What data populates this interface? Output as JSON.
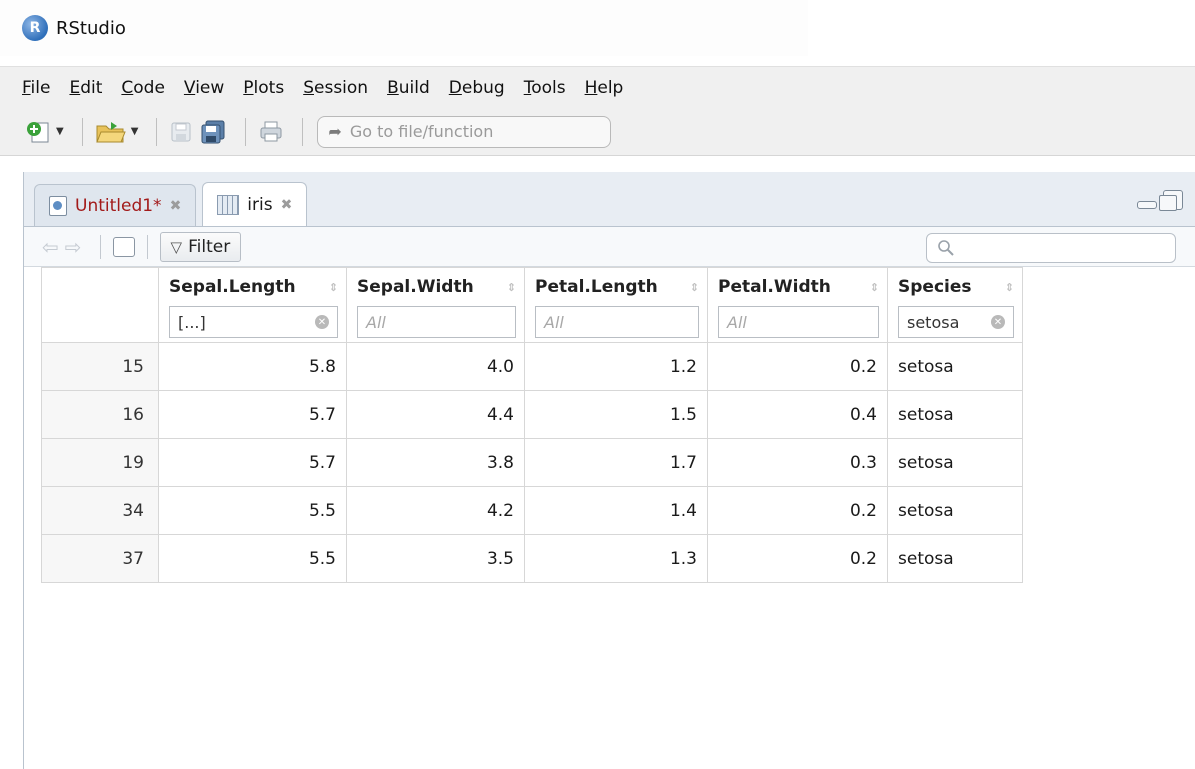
{
  "window": {
    "title": "RStudio"
  },
  "menu": [
    {
      "pre": "",
      "u": "F",
      "post": "ile"
    },
    {
      "pre": "",
      "u": "E",
      "post": "dit"
    },
    {
      "pre": "",
      "u": "C",
      "post": "ode"
    },
    {
      "pre": "",
      "u": "V",
      "post": "iew"
    },
    {
      "pre": "",
      "u": "P",
      "post": "lots"
    },
    {
      "pre": "",
      "u": "S",
      "post": "ession"
    },
    {
      "pre": "",
      "u": "B",
      "post": "uild"
    },
    {
      "pre": "",
      "u": "D",
      "post": "ebug"
    },
    {
      "pre": "",
      "u": "T",
      "post": "ools"
    },
    {
      "pre": "",
      "u": "H",
      "post": "elp"
    }
  ],
  "toolbar": {
    "goto_placeholder": "Go to file/function"
  },
  "tabs": [
    {
      "label": "Untitled1*",
      "modified": true
    },
    {
      "label": "iris",
      "modified": false
    }
  ],
  "viewer": {
    "filter_label": "Filter",
    "search_icon": "magnifier-icon"
  },
  "table": {
    "columns": [
      {
        "name": "Sepal.Length",
        "filter": "[...]",
        "filter_is_placeholder": false,
        "clearable": true
      },
      {
        "name": "Sepal.Width",
        "filter": "All",
        "filter_is_placeholder": true,
        "clearable": false
      },
      {
        "name": "Petal.Length",
        "filter": "All",
        "filter_is_placeholder": true,
        "clearable": false
      },
      {
        "name": "Petal.Width",
        "filter": "All",
        "filter_is_placeholder": true,
        "clearable": false
      },
      {
        "name": "Species",
        "filter": "setosa",
        "filter_is_placeholder": false,
        "clearable": true
      }
    ],
    "rows": [
      {
        "id": "15",
        "cells": [
          "5.8",
          "4.0",
          "1.2",
          "0.2",
          "setosa"
        ]
      },
      {
        "id": "16",
        "cells": [
          "5.7",
          "4.4",
          "1.5",
          "0.4",
          "setosa"
        ]
      },
      {
        "id": "19",
        "cells": [
          "5.7",
          "3.8",
          "1.7",
          "0.3",
          "setosa"
        ]
      },
      {
        "id": "34",
        "cells": [
          "5.5",
          "4.2",
          "1.4",
          "0.2",
          "setosa"
        ]
      },
      {
        "id": "37",
        "cells": [
          "5.5",
          "3.5",
          "1.3",
          "0.2",
          "setosa"
        ]
      }
    ]
  },
  "colors": {
    "accent": "#2f6fba",
    "modified_tab_text": "#a21a1a",
    "pane_bg": "#e8edf3"
  }
}
